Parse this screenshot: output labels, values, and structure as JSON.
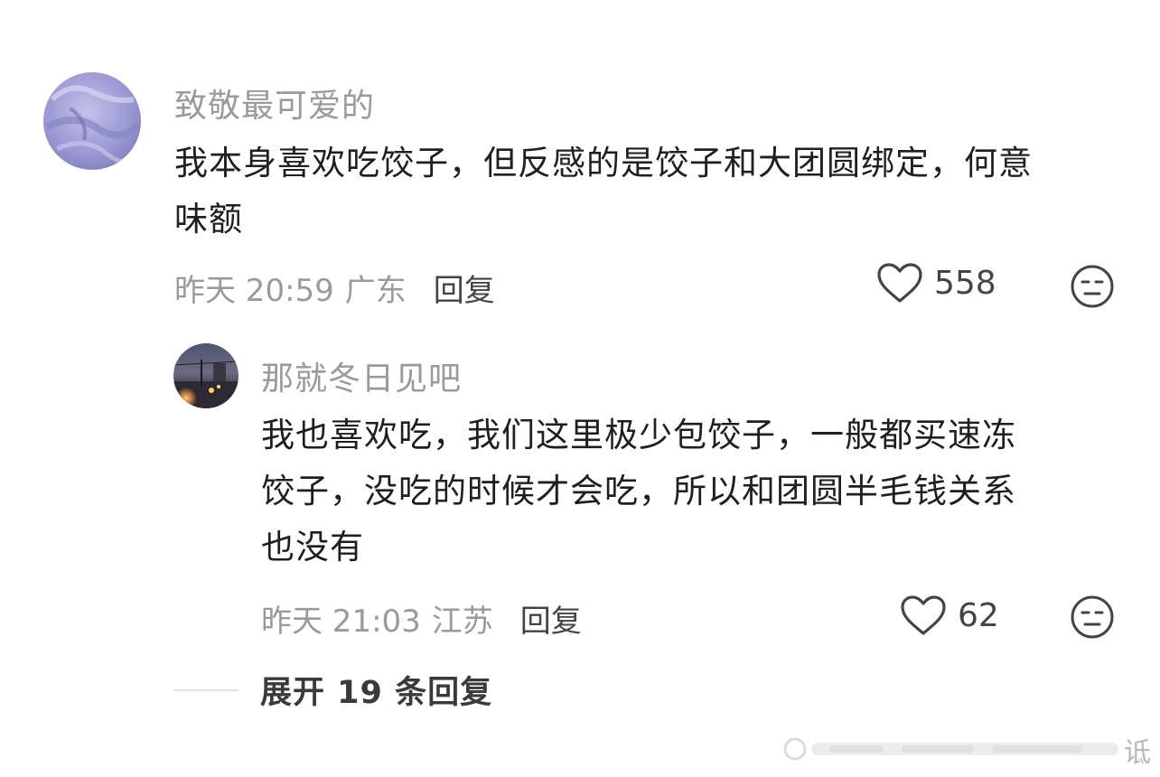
{
  "comments": [
    {
      "username": "致敬最可爱的",
      "text_line1": "我本身喜欢吃饺子，但反感的是饺子和大团圆绑定，何意",
      "text_line2": "味额",
      "time": "昨天 20:59",
      "location": "广东",
      "reply_label": "回复",
      "likes": "558"
    },
    {
      "username": "那就冬日见吧",
      "text_line1": "我也喜欢吃，我们这里极少包饺子，一般都买速冻",
      "text_line2": "饺子，没吃的时候才会吃，所以和团圆半毛钱关系",
      "text_line3": "也没有",
      "time": "昨天 21:03",
      "location": "江苏",
      "reply_label": "回复",
      "likes": "62"
    }
  ],
  "expand_replies": "展开 19 条回复",
  "watermark_char": "诋",
  "icons": {
    "like": "heart-outline-icon",
    "dislike": "meh-face-icon"
  },
  "colors": {
    "text": "#1f1f1f",
    "muted": "#9a9a9a",
    "icon": "#444444"
  }
}
